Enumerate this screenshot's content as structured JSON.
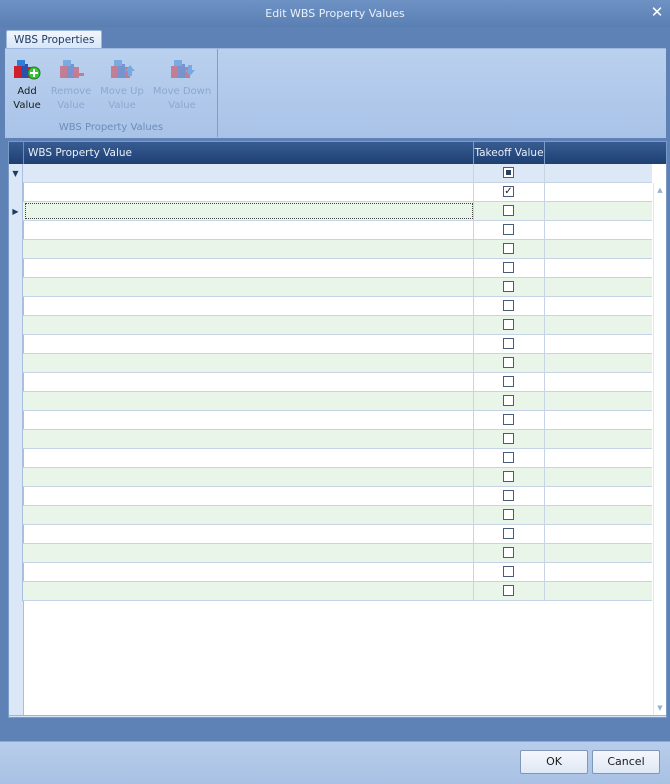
{
  "window": {
    "title": "Edit WBS Property Values"
  },
  "ribbon": {
    "tab": "WBS Properties",
    "group_label": "WBS Property Values",
    "buttons": [
      {
        "label1": "Add",
        "label2": "Value",
        "icon": "add-value-icon",
        "enabled": true
      },
      {
        "label1": "Remove",
        "label2": "Value",
        "icon": "remove-value-icon",
        "enabled": false
      },
      {
        "label1": "Move Up",
        "label2": "Value",
        "icon": "move-up-value-icon",
        "enabled": false
      },
      {
        "label1": "Move Down",
        "label2": "Value",
        "icon": "move-down-value-icon",
        "enabled": false
      }
    ]
  },
  "grid": {
    "columns": [
      "WBS Property Value",
      "Takeoff Value"
    ],
    "filter_row": {
      "takeoff": "indeterminate"
    },
    "rows": [
      {
        "value": "",
        "takeoff": true
      },
      {
        "value": "",
        "takeoff": false,
        "current": true
      },
      {
        "value": "",
        "takeoff": false
      },
      {
        "value": "",
        "takeoff": false
      },
      {
        "value": "",
        "takeoff": false
      },
      {
        "value": "",
        "takeoff": false
      },
      {
        "value": "",
        "takeoff": false
      },
      {
        "value": "",
        "takeoff": false
      },
      {
        "value": "",
        "takeoff": false
      },
      {
        "value": "",
        "takeoff": false
      },
      {
        "value": "",
        "takeoff": false
      },
      {
        "value": "",
        "takeoff": false
      },
      {
        "value": "",
        "takeoff": false
      },
      {
        "value": "",
        "takeoff": false
      },
      {
        "value": "",
        "takeoff": false
      },
      {
        "value": "",
        "takeoff": false
      },
      {
        "value": "",
        "takeoff": false
      },
      {
        "value": "",
        "takeoff": false
      },
      {
        "value": "",
        "takeoff": false
      },
      {
        "value": "",
        "takeoff": false
      },
      {
        "value": "",
        "takeoff": false
      },
      {
        "value": "",
        "takeoff": false
      }
    ]
  },
  "footer": {
    "ok": "OK",
    "cancel": "Cancel"
  },
  "colors": {
    "title_bar": "#5a7fb2",
    "grid_header": "#1e3f72",
    "alt_row": "#eaf5ea"
  }
}
